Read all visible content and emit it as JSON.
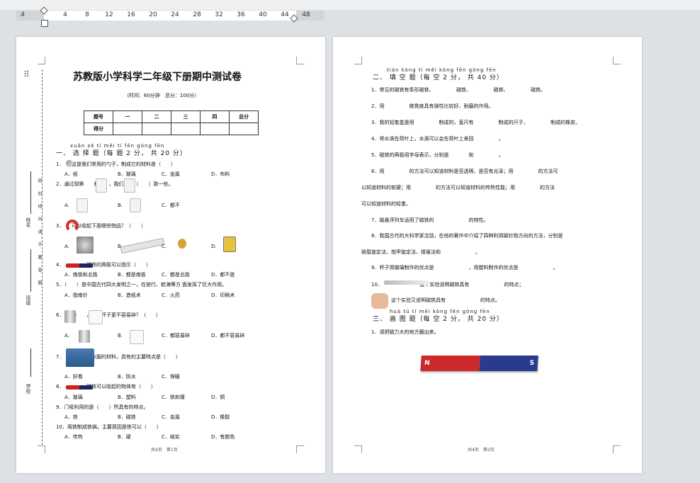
{
  "ruler": {
    "ticks": [
      "4",
      "4",
      "8",
      "12",
      "16",
      "20",
      "24",
      "28",
      "32",
      "36",
      "40",
      "44",
      "48"
    ]
  },
  "page1": {
    "title": "苏教版小学科学二年级下册期中测试卷",
    "subtitle": "（时间：60分钟　总分：100分）",
    "score_table": {
      "row1": [
        "题号",
        "一",
        "二",
        "三",
        "四",
        "总分"
      ],
      "row2": [
        "得分",
        "",
        "",
        "",
        "",
        ""
      ]
    },
    "sec1_pinyin": "xuǎn zé tí  měi tí  fēn  gòng  fēn",
    "sec1_title": "一、 选 择 题（每 题 2 分， 共 20 分）",
    "q1": "1．　　这是我们常用的勺子，制成它的材料是（　　）",
    "q1_opts": [
      "A．纸",
      "B．玻璃",
      "C．金属",
      "D．布料"
    ],
    "q2": "2．通过观察　　和　　，我们发现（　　）致一些。",
    "q2_opts": [
      "A.",
      "B.",
      "C．都不"
    ],
    "q3": "3．　　可以吸起下面哪些物品？（　　）",
    "q3_opts": [
      "A.",
      "B.",
      "C.",
      "D."
    ],
    "q4": "4．　　　　　磁铁的两极可以指示（　　）",
    "q4_opts": [
      "A．南极和北极",
      "B．都是南极",
      "C．都是北极",
      "D．都不是"
    ],
    "q5": "5．（　　）是中国古代四大发明之一，在旅行、航海等方 面发挥了巨大作用。",
    "q5_opts": [
      "A．指南针",
      "B．造纸术",
      "C．火药",
      "D．印刷术"
    ],
    "q6": "6．　　和　　，哪个杯子更不容易碎？（　　）",
    "q6_opts": [
      "A.",
      "B.",
      "C．都容易碎",
      "D．都不容易碎"
    ],
    "q7": "7．　　　　这件衣服的材料，具有的主要特点是（　　）",
    "q7_opts": [
      "A．好看",
      "B．防水",
      "C．保暖"
    ],
    "q8": "8．　　　　　磁铁可以吸起的物体有（　　）",
    "q8_opts": [
      "A．玻璃",
      "B．塑料",
      "C．铁和镍",
      "D．铜"
    ],
    "q9": "9．门吸利用的是（　　）所具有的特点。",
    "q9_opts": [
      "A．铁",
      "B．磁铁",
      "C．金属",
      "D．橡胶"
    ],
    "q10": "10．用铁制成铁锅，主要原因是铁可以（　　）",
    "q10_opts": [
      "A．传热",
      "B．硬",
      "C．结实",
      "D．有颜色"
    ],
    "side_labels": [
      "学校",
      "班级",
      "姓名",
      "考号"
    ],
    "side_note": "密　　封　　线　　内　　请　　不　　要　　答　　题",
    "footer": "共4页　第1页"
  },
  "page2": {
    "sec2_pinyin": "tián kòng  tí  měi kòng  fēn  gòng  fēn",
    "sec2_title": "二、 填 空 题（每 空 2 分， 共 40 分）",
    "lines": [
      "1．常见的磁铁有条形磁铁、　　　　　磁铁、　　　　　磁铁、　　　　　磁铁。",
      "2．用　　　　　做凳座具有弹性比较好、耐磨的作用。",
      "3．我的铅笔盒是用　　　　　制成的，直尺有　　　　　制成的尺子，　　　　　制成的橡皮。",
      "4．将水滴在荷叶上，水滴可以会在荷叶上来回　　　　　。",
      "5．磁铁的两极用字母表示，分别是　　　　和　　　　　。",
      "6．用　　　　　的方法可以知道材料是否透明、是否有光泽；用　　　　　的方法可",
      "以知道材料的软硬；用　　　　　的方法可以知道材料的传热性能；用　　　　　的方法",
      "可以知道材料的轻重。",
      "7．磁悬浮列车运用了磁铁的　　　　　　　的特性。",
      "8．我国古代的大科学家沈括，在他的著作中介绍了四种利用磁针指方向的方法，分别是",
      "碗唇旋定法、指甲旋定法、缕悬法和　　　　　　　。",
      "9．杯子用玻璃制作的优点是　　　　　　　，用塑料制作的优点是　　　　　　　。",
      "10．　　　　　　　　这个实验说明磁铁具有　　　　　　　的特点；",
      "　　　　这个实验又说明磁铁具有　　　　　　　的特点。"
    ],
    "sec3_pinyin": "huà  tú  tí  měi kòng  fēn  gòng  fēn",
    "sec3_title": "三、 画 图 题（每 空 2 分， 共 20 分）",
    "sec3_q1": "1．请把磁力大的地方圈出来。",
    "magnet_n": "N",
    "magnet_s": "S",
    "footer": "共4页　第2页"
  }
}
